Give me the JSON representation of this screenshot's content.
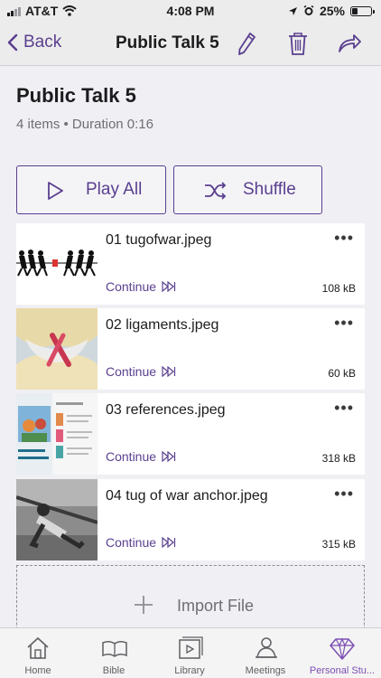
{
  "status": {
    "carrier": "AT&T",
    "time": "4:08 PM",
    "battery": "25%"
  },
  "nav": {
    "back_label": "Back",
    "title": "Public Talk 5"
  },
  "header": {
    "title": "Public Talk 5",
    "subtitle": "4 items • Duration 0:16"
  },
  "actions": {
    "play_all": "Play All",
    "shuffle": "Shuffle"
  },
  "items": [
    {
      "name": "01 tugofwar.jpeg",
      "continue": "Continue",
      "size": "108 kB",
      "more": "•••"
    },
    {
      "name": "02 ligaments.jpeg",
      "continue": "Continue",
      "size": "60 kB",
      "more": "•••"
    },
    {
      "name": "03 references.jpeg",
      "continue": "Continue",
      "size": "318 kB",
      "more": "•••"
    },
    {
      "name": "04 tug of war anchor.jpeg",
      "continue": "Continue",
      "size": "315 kB",
      "more": "•••"
    }
  ],
  "import": {
    "label": "Import File"
  },
  "tabs": [
    {
      "label": "Home",
      "icon": "home-icon"
    },
    {
      "label": "Bible",
      "icon": "bible-icon"
    },
    {
      "label": "Library",
      "icon": "library-icon"
    },
    {
      "label": "Meetings",
      "icon": "meetings-icon"
    },
    {
      "label": "Personal Stu...",
      "icon": "diamond-icon",
      "active": true
    }
  ],
  "colors": {
    "accent": "#5a3f8f",
    "tab_active": "#7b4fb2"
  }
}
